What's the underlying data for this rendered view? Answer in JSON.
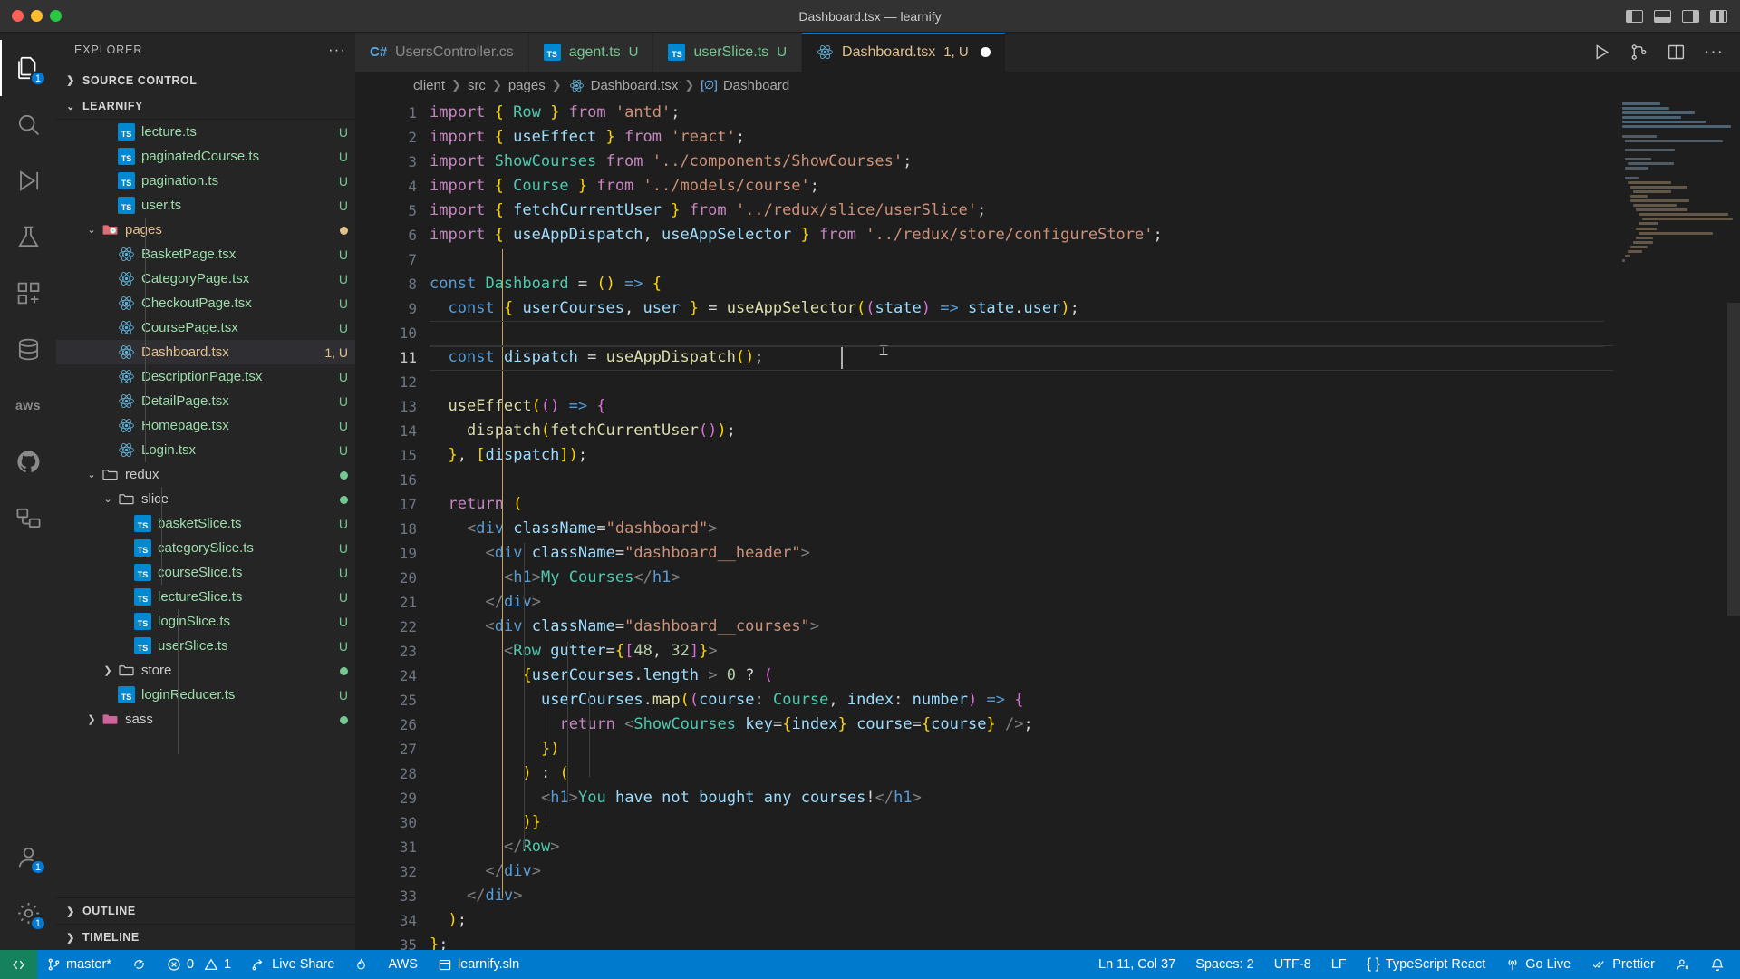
{
  "window": {
    "title": "Dashboard.tsx — learnify",
    "traffic_lights": [
      "close",
      "minimize",
      "zoom"
    ],
    "layout_icons": [
      "toggle-primary-sidebar",
      "toggle-panel",
      "toggle-secondary-sidebar",
      "customize-layout"
    ]
  },
  "activity_bar": {
    "items": [
      {
        "name": "explorer",
        "icon": "files-icon",
        "badge": "1",
        "active": true
      },
      {
        "name": "search",
        "icon": "search-icon",
        "badge": "",
        "active": false
      },
      {
        "name": "run-and-debug",
        "icon": "debug-icon",
        "badge": "",
        "active": false
      },
      {
        "name": "testing",
        "icon": "beaker-icon",
        "badge": "",
        "active": false
      },
      {
        "name": "extensions",
        "icon": "extensions-icon",
        "badge": "",
        "active": false
      },
      {
        "name": "database",
        "icon": "database-icon",
        "badge": "",
        "active": false
      },
      {
        "name": "aws",
        "icon": "aws-icon",
        "badge": "",
        "active": false
      },
      {
        "name": "github",
        "icon": "github-icon",
        "badge": "",
        "active": false
      },
      {
        "name": "remote-explorer",
        "icon": "remote-icon",
        "badge": "",
        "active": false
      }
    ],
    "bottom_items": [
      {
        "name": "accounts",
        "icon": "account-icon",
        "badge": "1"
      },
      {
        "name": "settings",
        "icon": "gear-icon",
        "badge": "1"
      }
    ]
  },
  "sidebar": {
    "header": "EXPLORER",
    "more_actions": "···",
    "sections": [
      {
        "label": "SOURCE CONTROL",
        "expanded": false
      },
      {
        "label": "LEARNIFY",
        "expanded": true
      }
    ],
    "bottom_sections": [
      {
        "label": "OUTLINE",
        "expanded": false
      },
      {
        "label": "TIMELINE",
        "expanded": false
      }
    ],
    "tree": [
      {
        "name": "lecture.ts",
        "icon": "ts-file-icon",
        "kind": "file",
        "depth": 4,
        "state": "U",
        "selected": false
      },
      {
        "name": "paginatedCourse.ts",
        "icon": "ts-file-icon",
        "kind": "file",
        "depth": 4,
        "state": "U",
        "selected": false
      },
      {
        "name": "pagination.ts",
        "icon": "ts-file-icon",
        "kind": "file",
        "depth": 4,
        "state": "U",
        "selected": false
      },
      {
        "name": "user.ts",
        "icon": "ts-file-icon",
        "kind": "file",
        "depth": 4,
        "state": "U",
        "selected": false
      },
      {
        "name": "pages",
        "icon": "folder-react-icon",
        "kind": "folder",
        "depth": 3,
        "state": "dot-amber",
        "expanded": true,
        "selected": false
      },
      {
        "name": "BasketPage.tsx",
        "icon": "react-file-icon",
        "kind": "file",
        "depth": 4,
        "state": "U",
        "selected": false
      },
      {
        "name": "CategoryPage.tsx",
        "icon": "react-file-icon",
        "kind": "file",
        "depth": 4,
        "state": "U",
        "selected": false
      },
      {
        "name": "CheckoutPage.tsx",
        "icon": "react-file-icon",
        "kind": "file",
        "depth": 4,
        "state": "U",
        "selected": false
      },
      {
        "name": "CoursePage.tsx",
        "icon": "react-file-icon",
        "kind": "file",
        "depth": 4,
        "state": "U",
        "selected": false
      },
      {
        "name": "Dashboard.tsx",
        "icon": "react-file-icon",
        "kind": "file",
        "depth": 4,
        "state": "1, U",
        "selected": true
      },
      {
        "name": "DescriptionPage.tsx",
        "icon": "react-file-icon",
        "kind": "file",
        "depth": 4,
        "state": "U",
        "selected": false
      },
      {
        "name": "DetailPage.tsx",
        "icon": "react-file-icon",
        "kind": "file",
        "depth": 4,
        "state": "U",
        "selected": false
      },
      {
        "name": "Homepage.tsx",
        "icon": "react-file-icon",
        "kind": "file",
        "depth": 4,
        "state": "U",
        "selected": false
      },
      {
        "name": "Login.tsx",
        "icon": "react-file-icon",
        "kind": "file",
        "depth": 4,
        "state": "U",
        "selected": false
      },
      {
        "name": "redux",
        "icon": "folder-icon",
        "kind": "folder",
        "depth": 3,
        "state": "dot-green",
        "expanded": true,
        "selected": false
      },
      {
        "name": "slice",
        "icon": "folder-icon",
        "kind": "folder",
        "depth": 4,
        "state": "dot-green",
        "expanded": true,
        "selected": false
      },
      {
        "name": "basketSlice.ts",
        "icon": "ts-file-icon",
        "kind": "file",
        "depth": 5,
        "state": "U",
        "selected": false
      },
      {
        "name": "categorySlice.ts",
        "icon": "ts-file-icon",
        "kind": "file",
        "depth": 5,
        "state": "U",
        "selected": false
      },
      {
        "name": "courseSlice.ts",
        "icon": "ts-file-icon",
        "kind": "file",
        "depth": 5,
        "state": "U",
        "selected": false
      },
      {
        "name": "lectureSlice.ts",
        "icon": "ts-file-icon",
        "kind": "file",
        "depth": 5,
        "state": "U",
        "selected": false
      },
      {
        "name": "loginSlice.ts",
        "icon": "ts-file-icon",
        "kind": "file",
        "depth": 5,
        "state": "U",
        "selected": false
      },
      {
        "name": "userSlice.ts",
        "icon": "ts-file-icon",
        "kind": "file",
        "depth": 5,
        "state": "U",
        "selected": false
      },
      {
        "name": "store",
        "icon": "folder-icon",
        "kind": "folder",
        "depth": 4,
        "state": "dot-green",
        "expanded": false,
        "selected": false
      },
      {
        "name": "loginReducer.ts",
        "icon": "ts-file-icon",
        "kind": "file",
        "depth": 4,
        "state": "U",
        "selected": false
      },
      {
        "name": "sass",
        "icon": "folder-sass-icon",
        "kind": "folder",
        "depth": 3,
        "state": "dot-green",
        "expanded": false,
        "selected": false
      }
    ]
  },
  "editor": {
    "tabs": [
      {
        "label": "UsersController.cs",
        "icon": "csharp-icon",
        "state": "",
        "active": false,
        "dirty": false
      },
      {
        "label": "agent.ts",
        "icon": "ts-file-icon",
        "state": "U",
        "active": false,
        "dirty": false
      },
      {
        "label": "userSlice.ts",
        "icon": "ts-file-icon",
        "state": "U",
        "active": false,
        "dirty": false
      },
      {
        "label": "Dashboard.tsx",
        "icon": "react-icon",
        "state": "1, U",
        "active": true,
        "dirty": true
      }
    ],
    "tab_actions": [
      "run-button",
      "split-source-control-icon",
      "split-editor-icon",
      "more-actions-icon"
    ],
    "breadcrumb": [
      {
        "label": "client",
        "icon": ""
      },
      {
        "label": "src",
        "icon": ""
      },
      {
        "label": "pages",
        "icon": ""
      },
      {
        "label": "Dashboard.tsx",
        "icon": "react-icon"
      },
      {
        "label": "Dashboard",
        "icon": "symbol-variable-icon"
      }
    ],
    "first_line": 1,
    "cursor_line": 11,
    "lines": [
      {
        "n": 1,
        "text": "import { Row } from 'antd';"
      },
      {
        "n": 2,
        "text": "import { useEffect } from 'react';"
      },
      {
        "n": 3,
        "text": "import ShowCourses from '../components/ShowCourses';"
      },
      {
        "n": 4,
        "text": "import { Course } from '../models/course';"
      },
      {
        "n": 5,
        "text": "import { fetchCurrentUser } from '../redux/slice/userSlice';"
      },
      {
        "n": 6,
        "text": "import { useAppDispatch, useAppSelector } from '../redux/store/configureStore';"
      },
      {
        "n": 7,
        "text": ""
      },
      {
        "n": 8,
        "text": "const Dashboard = () => {"
      },
      {
        "n": 9,
        "text": "  const { userCourses, user } = useAppSelector((state) => state.user);"
      },
      {
        "n": 10,
        "text": ""
      },
      {
        "n": 11,
        "text": "  const dispatch = useAppDispatch();"
      },
      {
        "n": 12,
        "text": ""
      },
      {
        "n": 13,
        "text": "  useEffect(() => {"
      },
      {
        "n": 14,
        "text": "    dispatch(fetchCurrentUser());"
      },
      {
        "n": 15,
        "text": "  }, [dispatch]);"
      },
      {
        "n": 16,
        "text": ""
      },
      {
        "n": 17,
        "text": "  return ("
      },
      {
        "n": 18,
        "text": "    <div className=\"dashboard\">"
      },
      {
        "n": 19,
        "text": "      <div className=\"dashboard__header\">"
      },
      {
        "n": 20,
        "text": "        <h1>My Courses</h1>"
      },
      {
        "n": 21,
        "text": "      </div>"
      },
      {
        "n": 22,
        "text": "      <div className=\"dashboard__courses\">"
      },
      {
        "n": 23,
        "text": "        <Row gutter={[48, 32]}>"
      },
      {
        "n": 24,
        "text": "          {userCourses.length > 0 ? ("
      },
      {
        "n": 25,
        "text": "            userCourses.map((course: Course, index: number) => {"
      },
      {
        "n": 26,
        "text": "              return <ShowCourses key={index} course={course} />;"
      },
      {
        "n": 27,
        "text": "            })"
      },
      {
        "n": 28,
        "text": "          ) : ("
      },
      {
        "n": 29,
        "text": "            <h1>You have not bought any courses!</h1>"
      },
      {
        "n": 30,
        "text": "          )}"
      },
      {
        "n": 31,
        "text": "        </Row>"
      },
      {
        "n": 32,
        "text": "      </div>"
      },
      {
        "n": 33,
        "text": "    </div>"
      },
      {
        "n": 34,
        "text": "  );"
      },
      {
        "n": 35,
        "text": "};"
      }
    ]
  },
  "status_bar": {
    "left": [
      {
        "name": "remote-host",
        "icon": "remote-icon",
        "label": ""
      },
      {
        "name": "branch",
        "icon": "source-control-icon",
        "label": "master*"
      },
      {
        "name": "sync-changes",
        "icon": "sync-icon",
        "label": ""
      },
      {
        "name": "problems",
        "icon": "error-warning-icon",
        "label": "0  1"
      },
      {
        "name": "live-share",
        "icon": "live-share-icon",
        "label": "Live Share"
      },
      {
        "name": "radon",
        "icon": "flame-icon",
        "label": ""
      },
      {
        "name": "aws",
        "icon": "aws-icon",
        "label": "AWS"
      },
      {
        "name": "solution",
        "icon": "window-icon",
        "label": "learnify.sln"
      }
    ],
    "problems_errors": "0",
    "problems_warnings": "1",
    "right": [
      {
        "name": "cursor-position",
        "icon": "",
        "label": "Ln 11, Col 37"
      },
      {
        "name": "indentation",
        "icon": "",
        "label": "Spaces: 2"
      },
      {
        "name": "encoding",
        "icon": "",
        "label": "UTF-8"
      },
      {
        "name": "eol",
        "icon": "",
        "label": "LF"
      },
      {
        "name": "language-mode",
        "icon": "braces-icon",
        "label": "TypeScript React"
      },
      {
        "name": "go-live",
        "icon": "broadcast-icon",
        "label": "Go Live"
      },
      {
        "name": "prettier",
        "icon": "checkcheck-icon",
        "label": "Prettier"
      },
      {
        "name": "feedback",
        "icon": "feedback-icon",
        "label": ""
      },
      {
        "name": "notifications",
        "icon": "bell-icon",
        "label": ""
      }
    ]
  },
  "colors": {
    "accent": "#007acc",
    "editor_bg": "#1e1e1e",
    "sidebar_bg": "#252526",
    "titlebar_bg": "#323233",
    "tab_active_bg": "#1e1e1e",
    "remote_green": "#16825d",
    "modified_amber": "#e2c08d",
    "untracked_green": "#73c991",
    "badge_blue": "#0078d4"
  }
}
